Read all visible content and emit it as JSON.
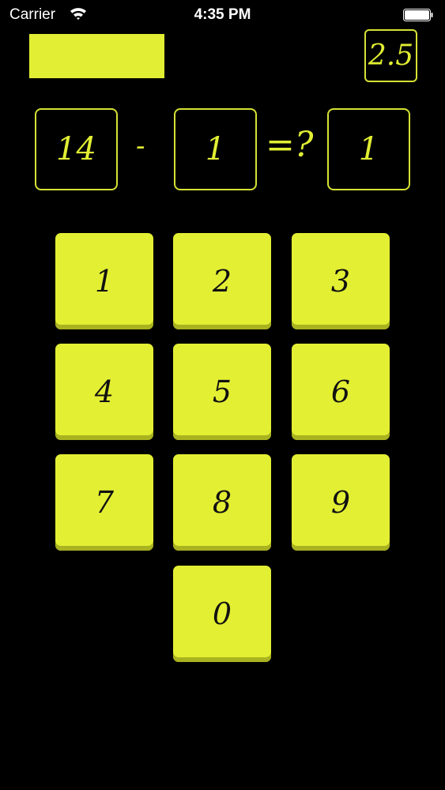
{
  "status_bar": {
    "carrier": "Carrier",
    "time": "4:35 PM"
  },
  "game": {
    "score": "2.5",
    "equation": {
      "operand_a": "14",
      "operator": "-",
      "operand_b": "1",
      "equals": "=?",
      "answer": "1"
    },
    "keypad": [
      "1",
      "2",
      "3",
      "4",
      "5",
      "6",
      "7",
      "8",
      "9",
      "0"
    ]
  },
  "colors": {
    "background": "#000000",
    "accent": "#e1ee33",
    "key_text": "#111111"
  }
}
